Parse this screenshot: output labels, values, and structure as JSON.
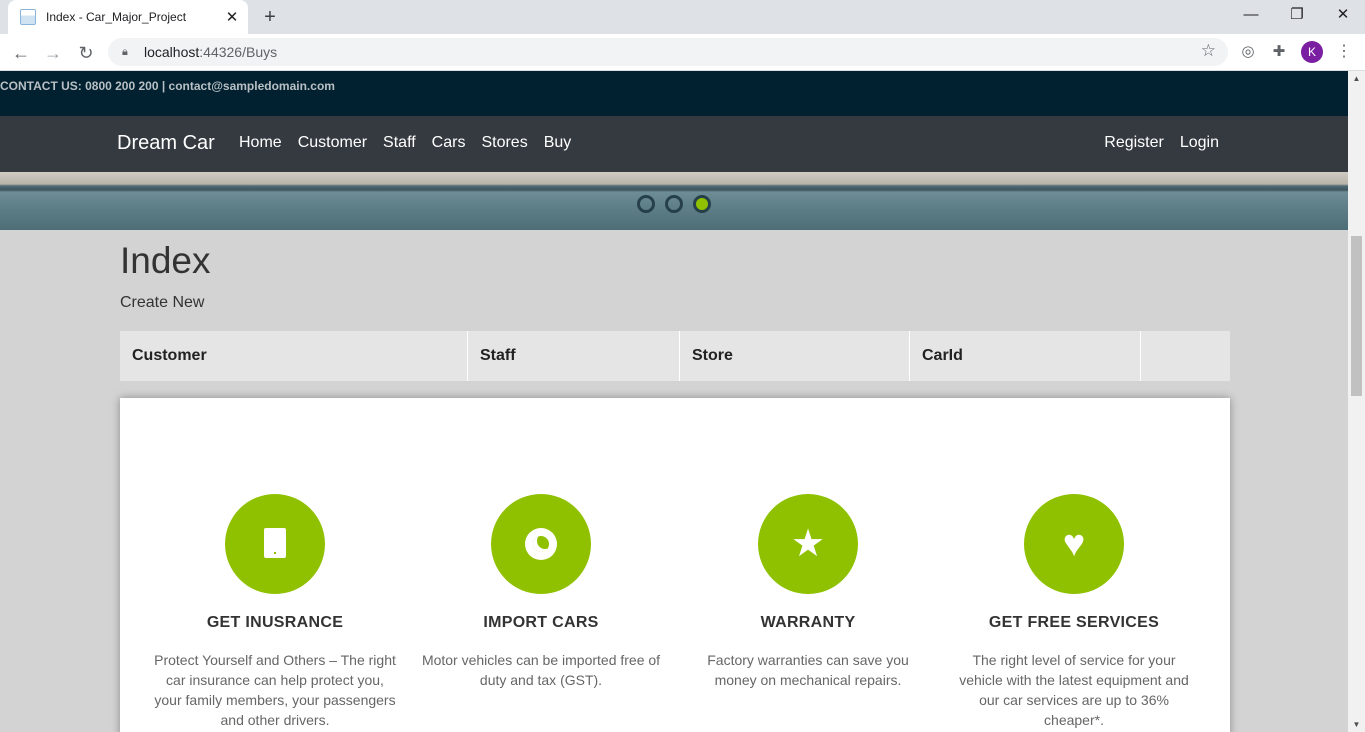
{
  "browser": {
    "tab_title": "Index - Car_Major_Project",
    "tab_close": "✕",
    "new_tab": "+",
    "url_host": "localhost",
    "url_path": ":44326/Buys",
    "avatar_letter": "K",
    "window_controls": [
      "—",
      "❐",
      "✕"
    ]
  },
  "site": {
    "contact": "CONTACT US: 0800 200 200 | contact@sampledomain.com",
    "brand": "Dream Car",
    "nav": [
      "Home",
      "Customer",
      "Staff",
      "Cars",
      "Stores",
      "Buy"
    ],
    "nav_right": [
      "Register",
      "Login"
    ],
    "carousel_active_index": 2
  },
  "page": {
    "title": "Index",
    "create_new": "Create New",
    "columns": [
      "Customer",
      "Staff",
      "Store",
      "CarId",
      ""
    ]
  },
  "features": [
    {
      "icon": "tablet-icon",
      "heading": "GET INUSRANCE",
      "desc": "Protect Yourself and Others – The right car insurance can help protect you, your family members, your passengers and other drivers."
    },
    {
      "icon": "ring-icon",
      "heading": "IMPORT CARS",
      "desc": "Motor vehicles can be imported free of duty and tax (GST)."
    },
    {
      "icon": "star-icon",
      "heading": "WARRANTY",
      "desc": "Factory warranties can save you money on mechanical repairs."
    },
    {
      "icon": "heart-icon",
      "heading": "GET FREE SERVICES",
      "desc": "The right level of service for your vehicle with the latest equipment and our car services are up to 36% cheaper*."
    }
  ],
  "colors": {
    "accent": "#8fc100",
    "navbar": "#343a40",
    "topbar": "#012030"
  }
}
